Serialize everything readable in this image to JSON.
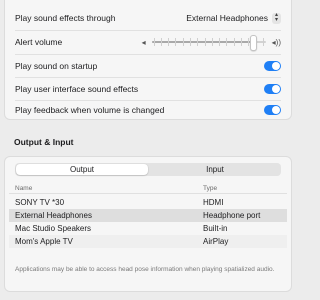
{
  "sound_effects": {
    "through_label": "Play sound effects through",
    "through_value": "External Headphones",
    "alert_volume_label": "Alert volume",
    "alert_volume_level": 0.88,
    "options": [
      {
        "label": "Play sound on startup",
        "on": true
      },
      {
        "label": "Play user interface sound effects",
        "on": true
      },
      {
        "label": "Play feedback when volume is changed",
        "on": true
      }
    ]
  },
  "output_input": {
    "title": "Output & Input",
    "tabs": [
      "Output",
      "Input"
    ],
    "active_tab": "Output",
    "columns": {
      "name": "Name",
      "type": "Type"
    },
    "devices": [
      {
        "name": "SONY TV  *30",
        "type": "HDMI"
      },
      {
        "name": "External Headphones",
        "type": "Headphone port"
      },
      {
        "name": "Mac Studio Speakers",
        "type": "Built-in"
      },
      {
        "name": "Mom's Apple TV",
        "type": "AirPlay"
      }
    ],
    "selected_device": "External Headphones",
    "note": "Applications may be able to access head pose information when playing spatialized audio."
  },
  "colors": {
    "accent": "#1f7ff5",
    "background": "#ececec"
  }
}
